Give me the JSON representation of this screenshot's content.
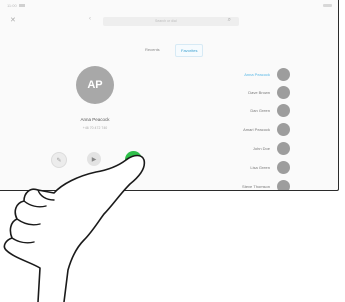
{
  "status": {
    "time": "11:00",
    "battery_label": ""
  },
  "header": {
    "close_icon": "close-icon",
    "back_icon": "chevron-left-icon",
    "search_placeholder": "Search or dial",
    "search_icon": "search-icon"
  },
  "tabs": [
    {
      "label": "Recents"
    },
    {
      "label": "Favorites",
      "active": true
    }
  ],
  "contact": {
    "initials": "AP",
    "name": "Anna Peacock",
    "number": "+46 70 472 740"
  },
  "actions": [
    {
      "icon": "edit-icon",
      "label": ""
    },
    {
      "icon": "video-icon",
      "label": ""
    },
    {
      "icon": "call-icon",
      "label": "",
      "color": "#2fbf4a"
    }
  ],
  "favorites": [
    {
      "name": "Anna Peacock",
      "selected": true
    },
    {
      "name": "Dave Brown"
    },
    {
      "name": "Dan Green"
    },
    {
      "name": "Amari Peacock"
    },
    {
      "name": "John Doe"
    },
    {
      "name": "Lisa Green"
    },
    {
      "name": "Steve Thomson"
    }
  ],
  "colors": {
    "accent": "#3aa0d0",
    "call_green": "#2fbf4a",
    "avatar_gray": "#a8a8a8"
  }
}
